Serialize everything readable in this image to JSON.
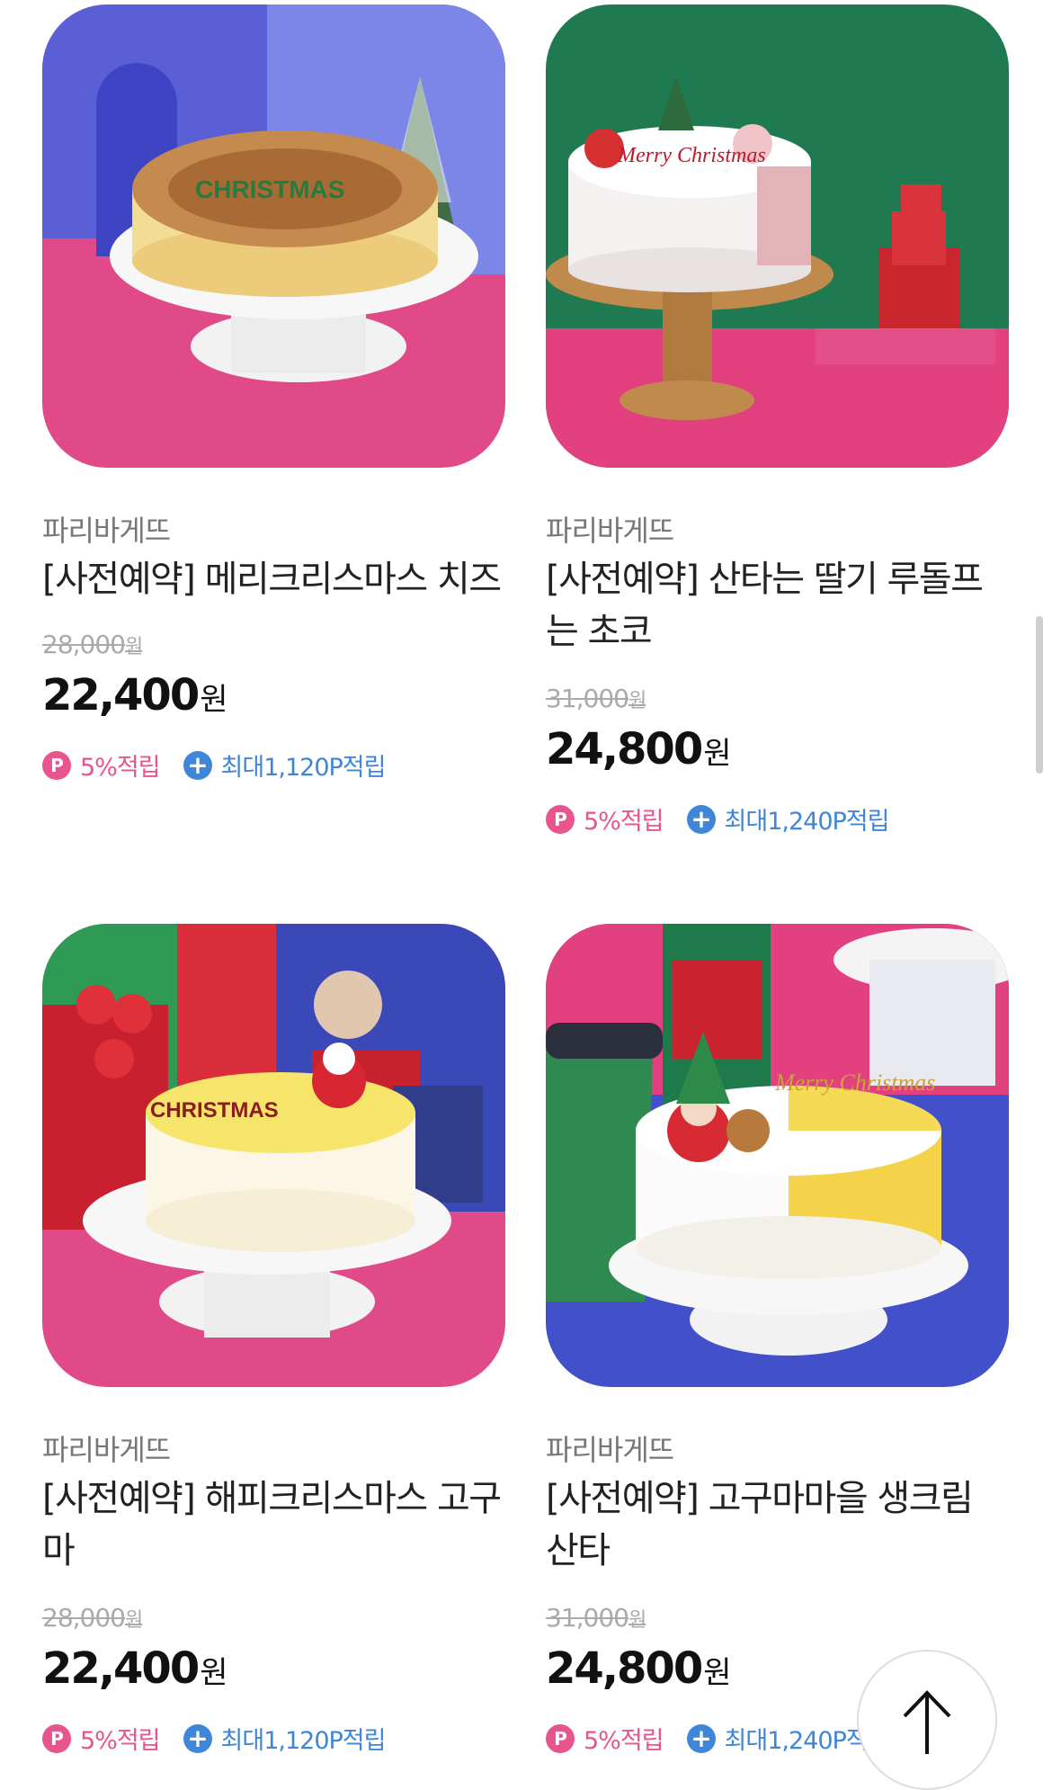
{
  "products": [
    {
      "brand": "파리바게뜨",
      "title": "[사전예약] 메리크리스마스 치즈",
      "original_price": "28,000",
      "price": "22,400",
      "currency": "원",
      "point_rate": "5%적립",
      "max_points": "최대1,120P적립",
      "image": "cheese-cake-photo"
    },
    {
      "brand": "파리바게뜨",
      "title": "[사전예약] 산타는 딸기 루돌프는 초코",
      "original_price": "31,000",
      "price": "24,800",
      "currency": "원",
      "point_rate": "5%적립",
      "max_points": "최대1,240P적립",
      "image": "strawberry-choco-cake-photo"
    },
    {
      "brand": "파리바게뜨",
      "title": "[사전예약] 해피크리스마스 고구마",
      "original_price": "28,000",
      "price": "22,400",
      "currency": "원",
      "point_rate": "5%적립",
      "max_points": "최대1,120P적립",
      "image": "sweet-potato-cake-photo"
    },
    {
      "brand": "파리바게뜨",
      "title": "[사전예약] 고구마마을 생크림 산타",
      "original_price": "31,000",
      "price": "24,800",
      "currency": "원",
      "point_rate": "5%적립",
      "max_points": "최대1,240P적",
      "image": "cream-santa-cake-photo"
    }
  ],
  "point_badge_letter": "P",
  "plus_symbol": "+",
  "scroll_top_icon": "arrow-up-icon",
  "colors": {
    "accent_pink": "#e8548e",
    "accent_blue": "#3f86d8"
  }
}
